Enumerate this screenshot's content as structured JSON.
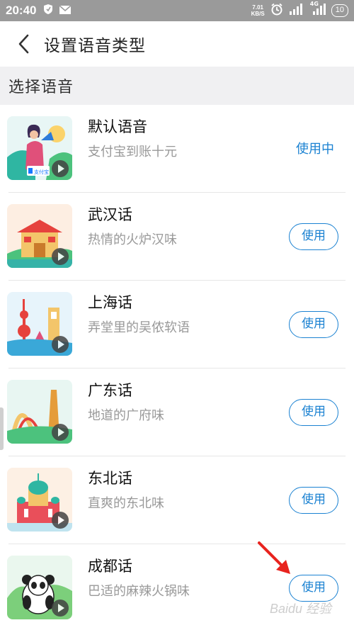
{
  "status_bar": {
    "time": "20:40",
    "speed_value": "7.01",
    "speed_unit": "KB/S",
    "network": "4G",
    "battery": "10"
  },
  "header": {
    "title": "设置语音类型",
    "back_icon": "chevron-left-icon"
  },
  "section": {
    "title": "选择语音"
  },
  "voices": [
    {
      "name": "默认语音",
      "desc": "支付宝到账十元",
      "action": "使用中",
      "active": true,
      "badge": "支付宝"
    },
    {
      "name": "武汉话",
      "desc": "热情的火炉汉味",
      "action": "使用",
      "active": false
    },
    {
      "name": "上海话",
      "desc": "弄堂里的吴侬软语",
      "action": "使用",
      "active": false
    },
    {
      "name": "广东话",
      "desc": "地道的广府味",
      "action": "使用",
      "active": false
    },
    {
      "name": "东北话",
      "desc": "直爽的东北味",
      "action": "使用",
      "active": false
    },
    {
      "name": "成都话",
      "desc": "巴适的麻辣火锅味",
      "action": "使用",
      "active": false
    }
  ],
  "watermark": "Baidu 经验",
  "colors": {
    "accent": "#1b82d2",
    "status_bar": "#9a9a9a",
    "section_bg": "#f0f0f2",
    "arrow": "#e8231e"
  }
}
